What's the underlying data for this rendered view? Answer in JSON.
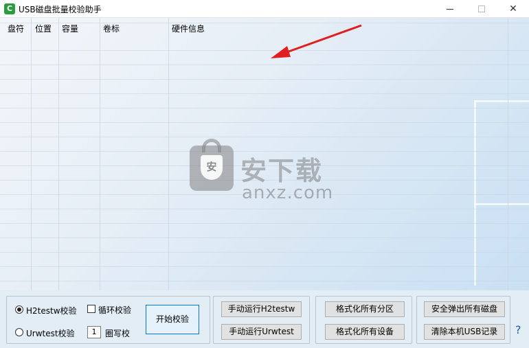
{
  "window": {
    "title": "USB磁盘批量校验助手",
    "icon_glyph": "C",
    "controls": {
      "minimize": "—",
      "maximize": "☐",
      "close": "✕"
    }
  },
  "table": {
    "columns": [
      "盘符",
      "位置",
      "容量",
      "卷标",
      "硬件信息"
    ],
    "rows": []
  },
  "watermark": {
    "brand_cn": "安下载",
    "brand_en": "anxz.com",
    "shield_glyph": "安"
  },
  "options": {
    "radio_h2testw": "H2testw校验",
    "radio_urwtest": "Urwtest校验",
    "loop_check": "循环校验",
    "circle_count_value": "1",
    "circle_label": "圈写校",
    "start_button": "开始校验"
  },
  "manual": {
    "run_h2testw": "手动运行H2testw",
    "run_urwtest": "手动运行Urwtest"
  },
  "format": {
    "format_partitions": "格式化所有分区",
    "format_devices": "格式化所有设备"
  },
  "safety": {
    "eject_all": "安全弹出所有磁盘",
    "clear_usb_records": "清除本机USB记录",
    "help": "?"
  },
  "colors": {
    "arrow": "#e02020",
    "app_icon": "#2e9b3e",
    "help": "#1a5fb4"
  }
}
